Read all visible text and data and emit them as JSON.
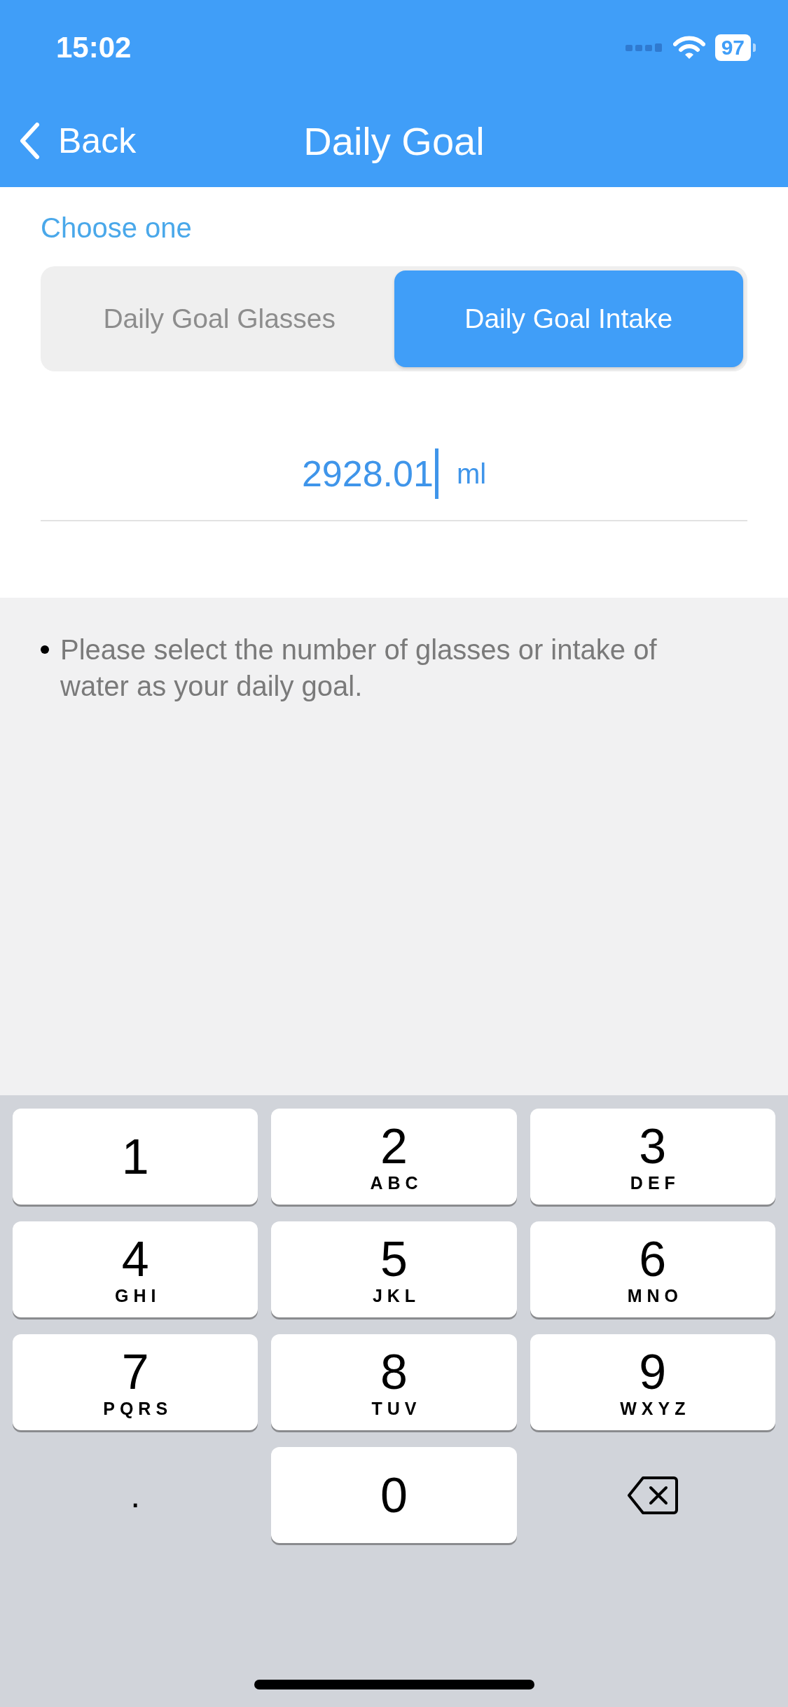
{
  "status_bar": {
    "time": "15:02",
    "battery": "97"
  },
  "nav_bar": {
    "back": "Back",
    "title": "Daily Goal"
  },
  "section_label": "Choose one",
  "segments": [
    {
      "label": "Daily Goal Glasses",
      "selected": false
    },
    {
      "label": "Daily Goal Intake",
      "selected": true
    }
  ],
  "intake": {
    "value": "2928.01",
    "unit": "ml"
  },
  "notes": [
    "Please select the number of glasses or intake of water as your daily goal."
  ],
  "keypad": [
    {
      "kind": "digit",
      "digit": "1"
    },
    {
      "kind": "digit",
      "digit": "2",
      "letters": "ABC"
    },
    {
      "kind": "digit",
      "digit": "3",
      "letters": "DEF"
    },
    {
      "kind": "digit",
      "digit": "4",
      "letters": "GHI"
    },
    {
      "kind": "digit",
      "digit": "5",
      "letters": "JKL"
    },
    {
      "kind": "digit",
      "digit": "6",
      "letters": "MNO"
    },
    {
      "kind": "digit",
      "digit": "7",
      "letters": "PQRS"
    },
    {
      "kind": "digit",
      "digit": "8",
      "letters": "TUV"
    },
    {
      "kind": "digit",
      "digit": "9",
      "letters": "WXYZ"
    },
    {
      "kind": "dot",
      "digit": "."
    },
    {
      "kind": "digit",
      "digit": "0"
    },
    {
      "kind": "delete"
    }
  ]
}
